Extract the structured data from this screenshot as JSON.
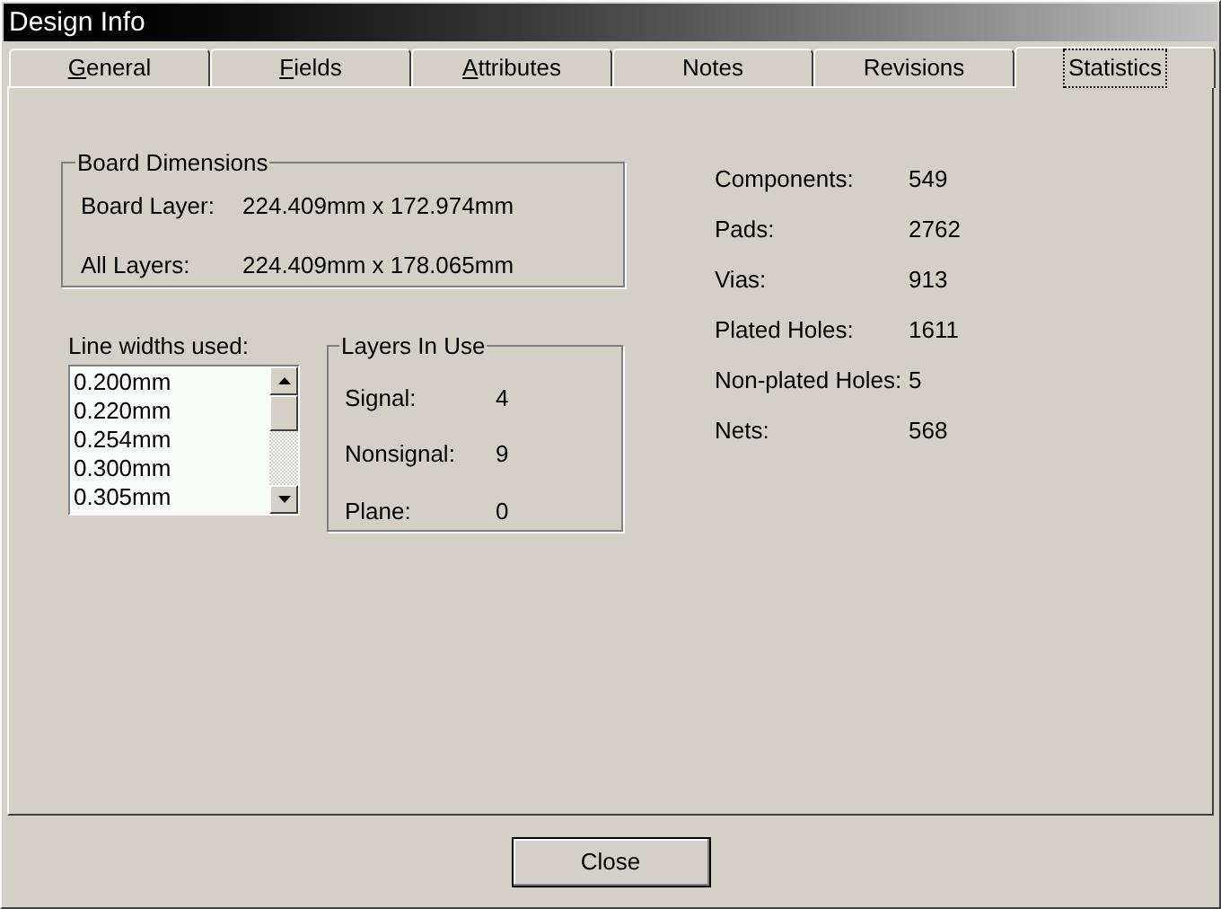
{
  "window": {
    "title": "Design Info"
  },
  "tabs": [
    {
      "label": "General",
      "mnemonic": true,
      "selected": false
    },
    {
      "label": "Fields",
      "mnemonic": true,
      "selected": false
    },
    {
      "label": "Attributes",
      "mnemonic": true,
      "selected": false
    },
    {
      "label": "Notes",
      "mnemonic": false,
      "selected": false
    },
    {
      "label": "Revisions",
      "mnemonic": false,
      "selected": false
    },
    {
      "label": "Statistics",
      "mnemonic": false,
      "selected": true
    }
  ],
  "board_dimensions": {
    "title": "Board Dimensions",
    "rows": [
      {
        "label": "Board Layer:",
        "value": "224.409mm x 172.974mm"
      },
      {
        "label": "All Layers:",
        "value": "224.409mm x 178.065mm"
      }
    ]
  },
  "line_widths": {
    "label": "Line widths used:",
    "items": [
      "0.200mm",
      "0.220mm",
      "0.254mm",
      "0.300mm",
      "0.305mm"
    ]
  },
  "layers_in_use": {
    "title": "Layers In Use",
    "rows": [
      {
        "label": "Signal:",
        "value": "4"
      },
      {
        "label": "Nonsignal:",
        "value": "9"
      },
      {
        "label": "Plane:",
        "value": "0"
      }
    ]
  },
  "statistics": [
    {
      "label": "Components:",
      "value": "549"
    },
    {
      "label": "Pads:",
      "value": "2762"
    },
    {
      "label": "Vias:",
      "value": "913"
    },
    {
      "label": "Plated Holes:",
      "value": "1611"
    },
    {
      "label": "Non-plated Holes:",
      "value": "5"
    },
    {
      "label": "Nets:",
      "value": "568"
    }
  ],
  "buttons": [
    {
      "label": "Close"
    }
  ]
}
